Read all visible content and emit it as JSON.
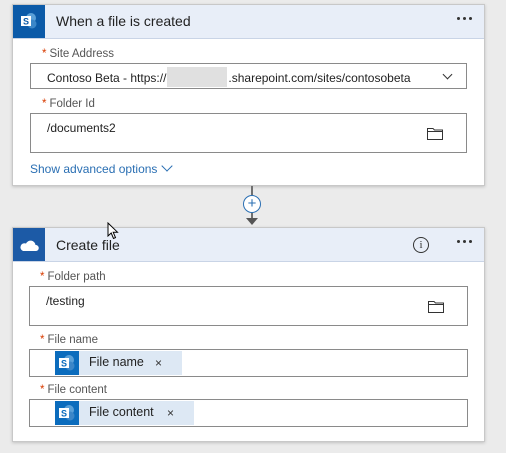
{
  "trigger_card": {
    "title": "When a file is created",
    "site_address": {
      "label": "Site Address",
      "required_mark": "*",
      "value_prefix": "Contoso Beta - https://",
      "value_suffix": ".sharepoint.com/sites/contosobeta"
    },
    "folder_id": {
      "label": "Folder Id",
      "required_mark": "*",
      "value": "/documents2"
    },
    "advanced_link": "Show advanced options"
  },
  "action_card": {
    "title": "Create file",
    "folder_path": {
      "label": "Folder path",
      "required_mark": "*",
      "value": "/testing"
    },
    "file_name": {
      "label": "File name",
      "required_mark": "*",
      "token": "File name",
      "remove_glyph": "×"
    },
    "file_content": {
      "label": "File content",
      "required_mark": "*",
      "token": "File content",
      "remove_glyph": "×"
    },
    "info_glyph": "i"
  },
  "connector": {
    "add_glyph": "+"
  },
  "colors": {
    "sharepoint_icon_bg": "#0b5aa8",
    "onedrive_icon_bg": "#1c5aa6",
    "header_bg": "#e8eef8",
    "link": "#2a6fb3",
    "required": "#d83b01"
  },
  "icons": {
    "trigger": "sharepoint-icon",
    "action": "onedrive-icon",
    "token": "sharepoint-icon",
    "folder": "folder-icon",
    "more": "ellipsis-icon",
    "info": "info-icon"
  }
}
